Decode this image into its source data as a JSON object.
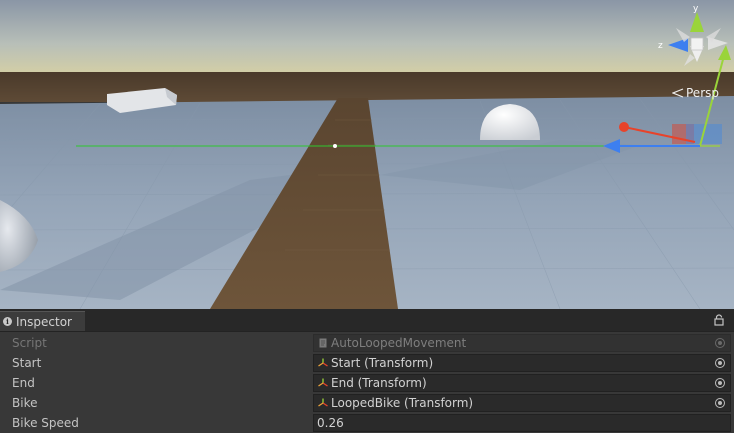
{
  "scene_view": {
    "projection_label": "Persp",
    "gizmo_axes": {
      "x": "x",
      "y": "y",
      "z": "z"
    },
    "colors": {
      "x_axis": "#e8432a",
      "y_axis": "#9ad43a",
      "z_axis": "#3d7ff0",
      "ground_path": "#6a5134"
    }
  },
  "inspector": {
    "tab_label": "Inspector",
    "icons": {
      "tab": "info-icon",
      "lock": "lock-icon"
    },
    "fields": [
      {
        "label": "Script",
        "value": "AutoLoopedMovement",
        "icon": "script-icon",
        "disabled": true,
        "has_picker": true
      },
      {
        "label": "Start",
        "value": "Start (Transform)",
        "icon": "transform-icon",
        "disabled": false,
        "has_picker": true
      },
      {
        "label": "End",
        "value": "End (Transform)",
        "icon": "transform-icon",
        "disabled": false,
        "has_picker": true
      },
      {
        "label": "Bike",
        "value": "LoopedBike (Transform)",
        "icon": "transform-icon",
        "disabled": false,
        "has_picker": true
      },
      {
        "label": "Bike Speed",
        "value": "0.26",
        "icon": "",
        "disabled": false,
        "has_picker": false
      }
    ]
  }
}
